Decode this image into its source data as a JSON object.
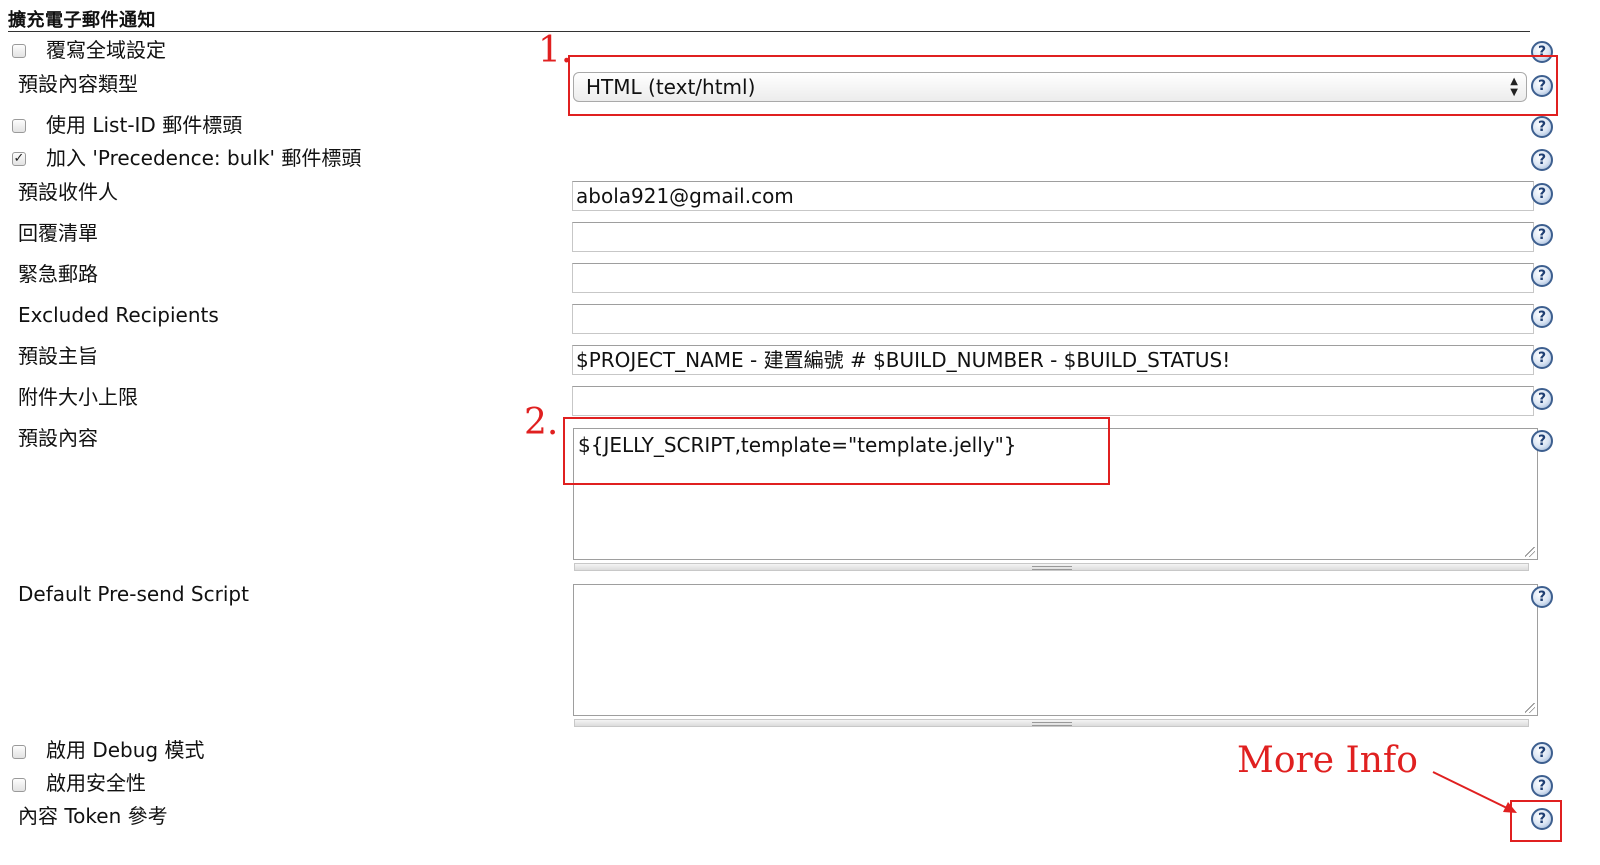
{
  "section": {
    "title": "擴充電子郵件通知"
  },
  "rows": {
    "override": {
      "label": "覆寫全域設定",
      "checked": false
    },
    "content_type": {
      "label": "預設內容類型",
      "value": "HTML (text/html)"
    },
    "list_id": {
      "label": "使用 List-ID 郵件標頭",
      "checked": false
    },
    "precedence": {
      "label": "加入 'Precedence: bulk' 郵件標頭",
      "checked": true,
      "mark": "✓"
    },
    "recipients": {
      "label": "預設收件人",
      "value": "abola921@gmail.com"
    },
    "reply_to": {
      "label": "回覆清單",
      "value": ""
    },
    "emergency": {
      "label": "緊急郵路",
      "value": ""
    },
    "excluded": {
      "label": "Excluded Recipients",
      "value": ""
    },
    "subject": {
      "label": "預設主旨",
      "value": "$PROJECT_NAME - 建置編號 # $BUILD_NUMBER - $BUILD_STATUS!"
    },
    "attach_max": {
      "label": "附件大小上限",
      "value": ""
    },
    "content": {
      "label": "預設內容",
      "value": "${JELLY_SCRIPT,template=\"template.jelly\"}"
    },
    "presend": {
      "label": "Default Pre-send Script",
      "value": ""
    },
    "debug": {
      "label": "啟用 Debug 模式",
      "checked": false
    },
    "security": {
      "label": "啟用安全性",
      "checked": false
    },
    "token_ref": {
      "label": "內容 Token 參考"
    }
  },
  "help": {
    "glyph": "?"
  },
  "annotations": {
    "one": "1.",
    "two": "2.",
    "more_info": "More  Info",
    "color": "#e02020"
  }
}
